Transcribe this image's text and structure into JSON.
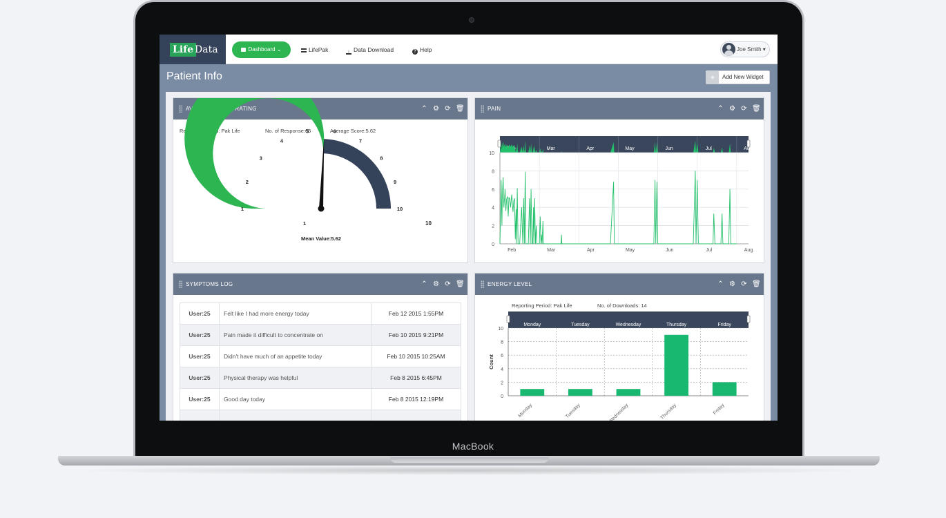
{
  "device": {
    "brand_label": "MacBook"
  },
  "app": {
    "logo_part1": "Life",
    "logo_part2": "Data",
    "nav": {
      "dashboard": "Dashboard ⌄",
      "lifepak": "LifePak",
      "data_download": "Data Download",
      "help": "Help"
    },
    "user_name": "Joe Smith ▾"
  },
  "page": {
    "title": "Patient Info",
    "add_widget_icon": "+",
    "add_widget_label": "Add New Widget"
  },
  "icons": {
    "collapse": "chevron-up-icon",
    "settings": "gear-icon",
    "refresh": "refresh-icon",
    "delete": "trash-icon"
  },
  "colors": {
    "accent_green": "#2db552",
    "navy": "#34425a",
    "header_gray": "#69778d",
    "chart_green": "#19b871"
  },
  "widgets": {
    "mood": {
      "title": "AVERAGE MOOD RATING",
      "reporting_period": "Reporting Period: Pak Life",
      "responses": "No. of Response:65",
      "average_score": "Average Score:5.62",
      "gauge_min": "1",
      "gauge_max": "10",
      "mean_value": "Mean Value:5.62",
      "chart_data": {
        "type": "gauge",
        "min": 1,
        "max": 10,
        "value": 5.62,
        "tick_labels": [
          "1",
          "2",
          "3",
          "4",
          "5",
          "6",
          "7",
          "8",
          "9",
          "10"
        ],
        "colors": {
          "filled": "#2db552",
          "remaining": "#34425a"
        }
      }
    },
    "pain": {
      "title": "PAIN",
      "chart_data": {
        "type": "line",
        "x_labels": [
          "Feb",
          "Mar",
          "Apr",
          "May",
          "Jun",
          "Jul",
          "Aug"
        ],
        "y_ticks": [
          "0",
          "2",
          "4",
          "6",
          "8",
          "10"
        ],
        "ylim": [
          0,
          10
        ],
        "navigator_labels": [
          "Feb",
          "Mar",
          "Apr",
          "May",
          "Jun",
          "Jul",
          "Aug"
        ],
        "series": [
          {
            "x": [
              0,
              0.02,
              0.03,
              0.05,
              0.06,
              0.08,
              0.1,
              0.12,
              0.13,
              0.15,
              0.17,
              0.19,
              0.21,
              0.23,
              0.25,
              0.27,
              0.3,
              0.33,
              0.35,
              0.37,
              0.39,
              0.41,
              0.42,
              0.44,
              0.46,
              0.5,
              0.55,
              0.58,
              0.6,
              0.62,
              0.64,
              0.66,
              0.72,
              0.75,
              0.77,
              0.79,
              0.81,
              0.83,
              0.85,
              0.86,
              0.88,
              0.9,
              0.92,
              0.94,
              0.96,
              1,
              1.02,
              1.04,
              1.05,
              1.07,
              1.09,
              1.1,
              1.12,
              1.14,
              1.3,
              1.55,
              1.56,
              1.57,
              1.58,
              1.6,
              1.8,
              2.0,
              2.5,
              2.8,
              2.88,
              2.9,
              2.92,
              3.0,
              3.5,
              3.9,
              3.93,
              3.95,
              3.98,
              4.0,
              4.02,
              4.05,
              4.5,
              4.9,
              4.95,
              4.97,
              5.0,
              5.03,
              5.05,
              5.3,
              5.4,
              5.42,
              5.45,
              5.5,
              5.6,
              5.63,
              5.65,
              5.8,
              5.83,
              5.85,
              6.0
            ],
            "y": [
              0,
              4,
              7,
              2,
              5,
              7.3,
              4,
              5.2,
              6,
              3.6,
              4.9,
              5.2,
              3,
              5.1,
              4.9,
              4,
              5.4,
              3.5,
              4.7,
              5,
              0.5,
              3.8,
              0,
              6.1,
              0,
              0,
              4,
              0,
              5,
              0,
              7.9,
              0,
              0,
              5,
              0,
              6,
              0,
              0,
              4,
              0,
              5,
              0,
              2,
              0,
              0,
              0,
              3,
              0,
              1,
              0,
              2.5,
              0,
              0,
              0,
              0,
              0,
              1,
              0,
              0,
              0,
              0,
              0,
              0,
              0,
              6.8,
              0,
              0,
              0,
              0,
              0,
              7,
              0,
              6.8,
              0,
              0,
              0,
              0,
              0,
              8,
              0,
              7,
              0,
              0,
              0,
              0,
              3.3,
              0,
              0,
              0,
              3.3,
              0,
              0,
              6,
              0,
              0
            ]
          }
        ]
      }
    },
    "symptoms": {
      "title": "SYMPTOMS LOG",
      "rows": [
        {
          "user": "User:25",
          "text": "Felt like I had more energy today",
          "date": "Feb 12 2015 1:55PM"
        },
        {
          "user": "User:25",
          "text": "Pain made it difficult to concentrate on",
          "date": "Feb 10 2015 9:21PM"
        },
        {
          "user": "User:25",
          "text": "Didn't have much of an appetite today",
          "date": "Feb 10 2015 10:25AM"
        },
        {
          "user": "User:25",
          "text": "Physical therapy was helpful",
          "date": "Feb 8 2015 6:45PM"
        },
        {
          "user": "User:25",
          "text": "Good day today",
          "date": "Feb 8 2015 12:19PM"
        },
        {
          "user": "",
          "text": "",
          "date": ""
        }
      ]
    },
    "energy": {
      "title": "ENERGY LEVEL",
      "reporting_period": "Reporting Period: Pak Life",
      "downloads": "No. of Downloads: 14",
      "chart_data": {
        "type": "bar",
        "categories": [
          "Monday",
          "Tuesday",
          "Wednesday",
          "Thursday",
          "Friday"
        ],
        "values": [
          1,
          1,
          1,
          9,
          2
        ],
        "ylabel": "Count",
        "ylim": [
          0,
          10
        ],
        "y_ticks": [
          "0",
          "2",
          "4",
          "6",
          "8",
          "10"
        ],
        "navigator_labels": [
          "Monday",
          "Tuesday",
          "Wednesday",
          "Thursday",
          "Friday"
        ],
        "grid": true
      }
    }
  }
}
